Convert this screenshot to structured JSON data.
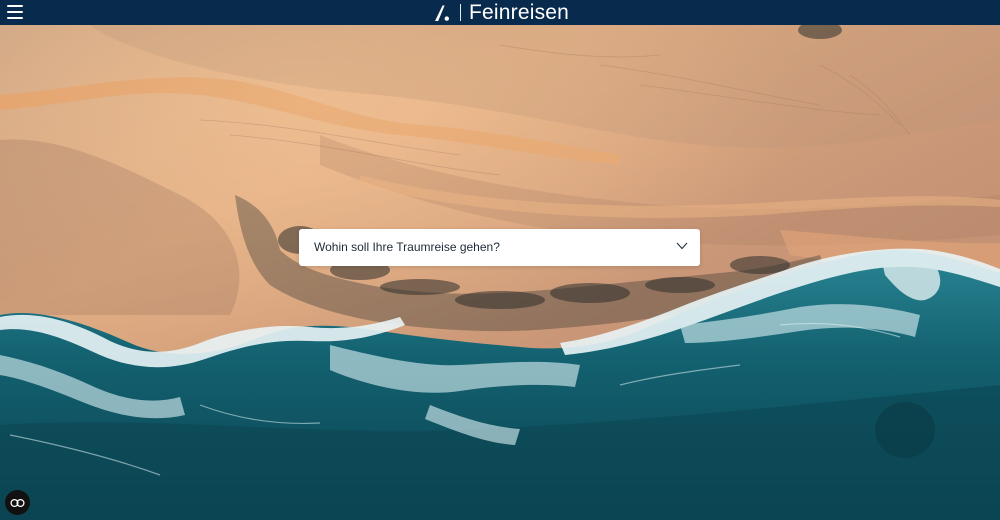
{
  "header": {
    "brand_name": "Feinreisen",
    "menu_icon": "hamburger-menu-icon",
    "logo_icon": "feinreisen-logo-mark"
  },
  "search": {
    "destination_placeholder": "Wohin soll Ihre Traumreise gehen?",
    "chevron_icon": "chevron-down-icon"
  },
  "accessibility": {
    "icon": "eye-accessibility-icon"
  },
  "colors": {
    "header_bg": "#082a4d",
    "sand": "#dca57e",
    "ocean": "#0f5866",
    "foam": "#e6f2f5"
  }
}
